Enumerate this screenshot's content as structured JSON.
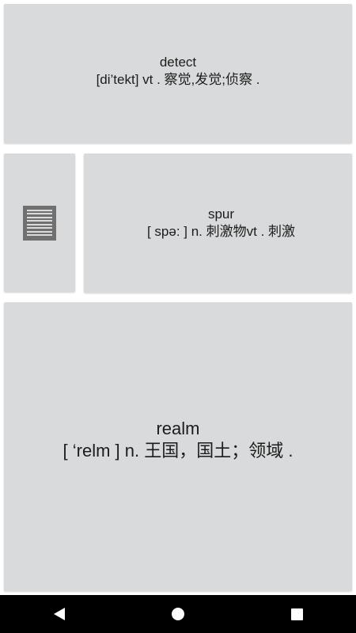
{
  "cards": [
    {
      "word": "detect",
      "definition": "[di’tekt]  vt . 察觉,发觉;侦察  ."
    },
    {
      "word": "spur",
      "definition": "[ spə: ]  n. 刺激物vt . 刺激"
    },
    {
      "word": "realm",
      "definition": "[ ‘relm ] n. 王国，国土；领域 ."
    }
  ],
  "icons": {
    "list": "list-lines-icon",
    "back": "back-icon",
    "home": "home-icon",
    "recents": "recents-icon"
  },
  "colors": {
    "card_background": "#d9dadb",
    "icon_fill": "#707070",
    "navbar": "#000000"
  }
}
